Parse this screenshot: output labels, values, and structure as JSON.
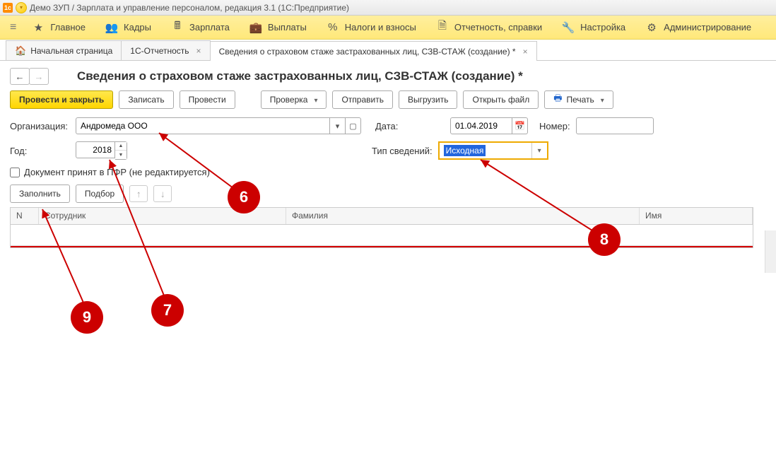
{
  "window_title": "Демо ЗУП / Зарплата и управление персоналом, редакция 3.1  (1С:Предприятие)",
  "menu": {
    "main": "Главное",
    "hr": "Кадры",
    "salary": "Зарплата",
    "payments": "Выплаты",
    "taxes": "Налоги и взносы",
    "reports": "Отчетность, справки",
    "settings": "Настройка",
    "admin": "Администрирование"
  },
  "tabs": {
    "home": "Начальная страница",
    "t1": "1С-Отчетность",
    "t2": "Сведения о страховом стаже застрахованных лиц, СЗВ-СТАЖ (создание) *"
  },
  "page_title": "Сведения о страховом стаже застрахованных лиц, СЗВ-СТАЖ (создание) *",
  "toolbar": {
    "post_close": "Провести и закрыть",
    "save": "Записать",
    "post": "Провести",
    "check": "Проверка",
    "send": "Отправить",
    "export": "Выгрузить",
    "open_file": "Открыть файл",
    "print": "Печать"
  },
  "form": {
    "org_label": "Организация:",
    "org_value": "Андромеда ООО",
    "date_label": "Дата:",
    "date_value": "01.04.2019",
    "number_label": "Номер:",
    "number_value": "",
    "year_label": "Год:",
    "year_value": "2018",
    "type_label": "Тип сведений:",
    "type_value": "Исходная",
    "doc_accepted": "Документ принят в ПФР (не редактируется)"
  },
  "sub_toolbar": {
    "fill": "Заполнить",
    "pick": "Подбор"
  },
  "grid": {
    "col_n": "N",
    "col_employee": "Сотрудник",
    "col_lastname": "Фамилия",
    "col_name": "Имя"
  },
  "callouts": {
    "c6": "6",
    "c7": "7",
    "c8": "8",
    "c9": "9"
  }
}
